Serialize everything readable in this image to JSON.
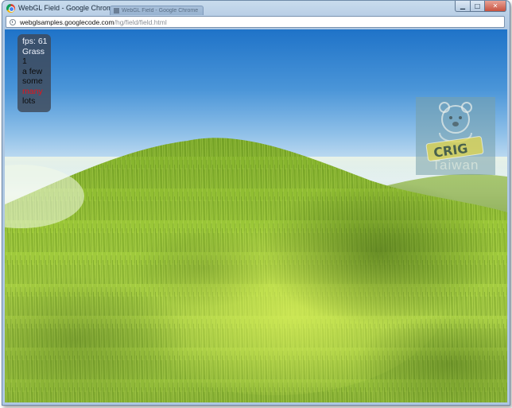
{
  "window": {
    "title": "WebGL Field - Google Chrome",
    "background_tab_title": "WebGL Field - Google Chrome"
  },
  "address_bar": {
    "host": "webglsamples.googlecode.com",
    "path": "/hg/field/field.html"
  },
  "overlay": {
    "fps_label": "fps: 61",
    "heading": "Grass",
    "options": [
      {
        "label": "1",
        "selected": false
      },
      {
        "label": "a few",
        "selected": false
      },
      {
        "label": "some",
        "selected": false
      },
      {
        "label": "many",
        "selected": true
      },
      {
        "label": "lots",
        "selected": false
      }
    ]
  },
  "watermark": {
    "logo_text": "Taiwan"
  },
  "colors": {
    "selected_option": "#e3141b",
    "panel_bg": "#3e4858",
    "grass_light": "#c8e64a",
    "grass_dark": "#3f6a16"
  },
  "icons": [
    "chrome-logo-icon",
    "minimize-icon",
    "maximize-icon",
    "close-icon",
    "page-icon"
  ]
}
